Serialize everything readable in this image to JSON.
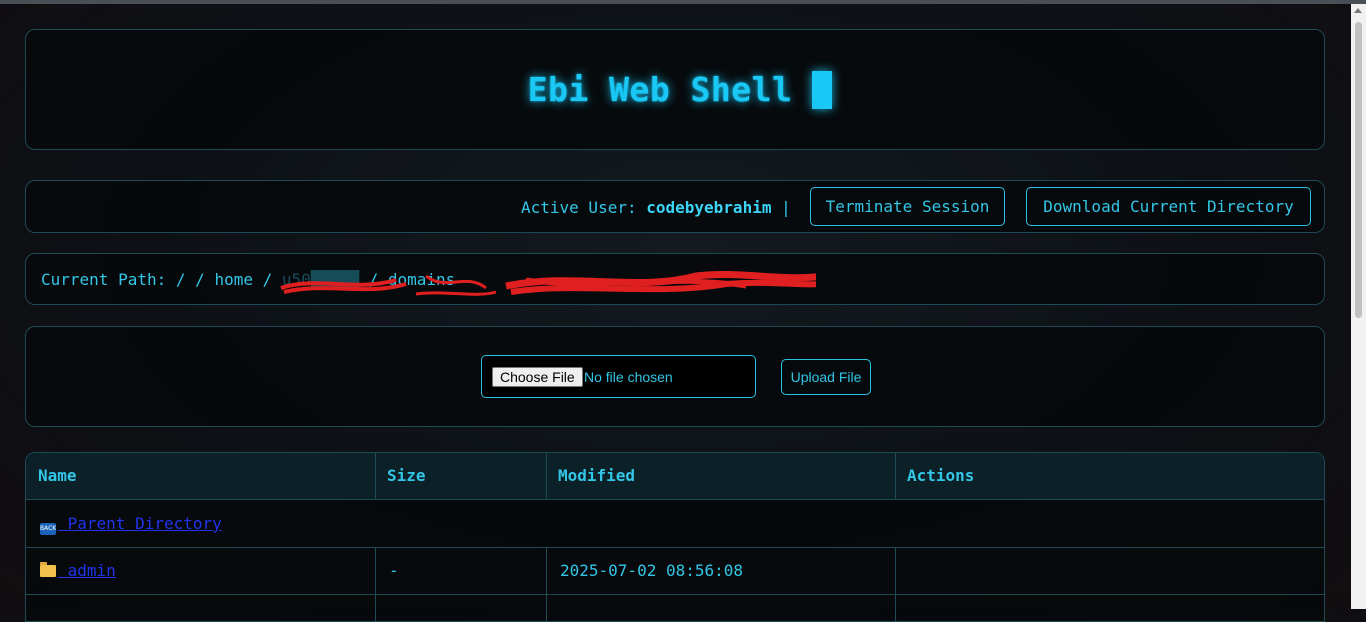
{
  "app": {
    "title": "Ebi Web Shell"
  },
  "userbar": {
    "label": "Active User:",
    "username": "codebyebrahim",
    "separator": "|",
    "terminate_label": "Terminate Session",
    "download_label": "Download Current Directory"
  },
  "path": {
    "label": "Current Path:",
    "crumbs": [
      "/",
      "/",
      "home",
      "/",
      "u50[redacted]",
      "/",
      "domains",
      "[redacted]"
    ]
  },
  "upload": {
    "choose_label": "Choose File",
    "no_file_text": "No file chosen",
    "upload_label": "Upload File"
  },
  "table": {
    "headers": [
      "Name",
      "Size",
      "Modified",
      "Actions"
    ],
    "rows": [
      {
        "icon": "back-icon",
        "name": "Parent Directory",
        "size": "",
        "modified": "",
        "actions": ""
      },
      {
        "icon": "folder-icon",
        "name": "admin",
        "size": "-",
        "modified": "2025-07-02 08:56:08",
        "actions": ""
      }
    ]
  },
  "colors": {
    "accent": "#19c8f5",
    "text": "#33c6e6",
    "link": "#2233ee",
    "border": "#1e4a56",
    "redaction": "#e02020"
  }
}
